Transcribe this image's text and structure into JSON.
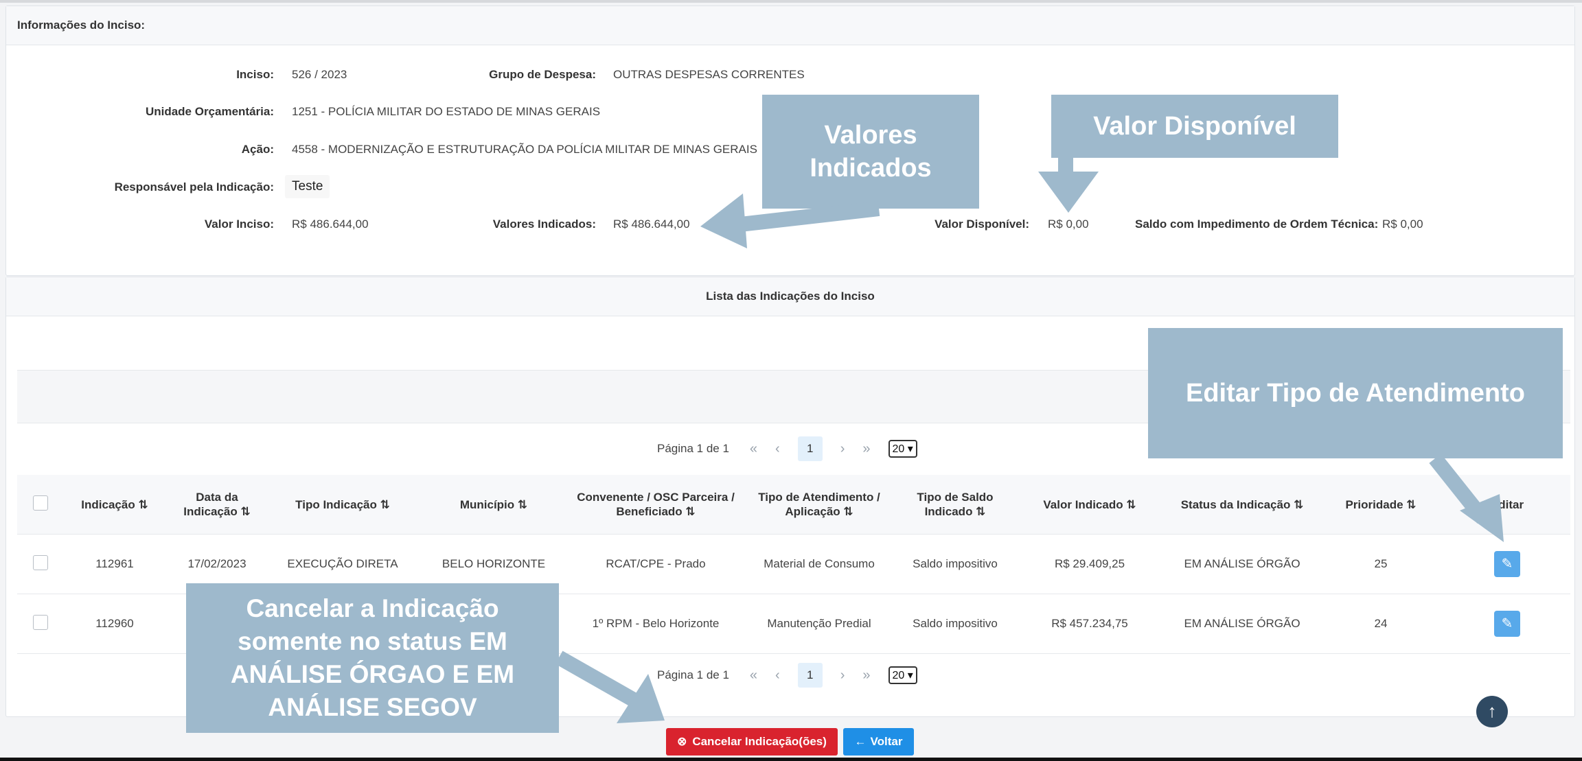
{
  "info": {
    "title": "Informações do Inciso:",
    "inciso_label": "Inciso:",
    "inciso_value": "526 / 2023",
    "grupo_label": "Grupo de Despesa:",
    "grupo_value": "OUTRAS DESPESAS CORRENTES",
    "unidade_label": "Unidade Orçamentária:",
    "unidade_value": "1251 - POLÍCIA MILITAR DO ESTADO DE MINAS GERAIS",
    "acao_label": "Ação:",
    "acao_value": "4558 - MODERNIZAÇÃO E ESTRUTURAÇÃO DA POLÍCIA MILITAR DE MINAS GERAIS",
    "responsavel_label": "Responsável pela Indicação:",
    "responsavel_value": "Teste",
    "valor_inciso_label": "Valor Inciso:",
    "valor_inciso_value": "R$ 486.644,00",
    "valores_indicados_label": "Valores Indicados:",
    "valores_indicados_value": "R$ 486.644,00",
    "valor_disponivel_label": "Valor Disponível:",
    "valor_disponivel_value": "R$ 0,00",
    "saldo_label": "Saldo com Impedimento de Ordem Técnica:",
    "saldo_value": "R$ 0,00"
  },
  "list": {
    "title": "Lista das Indicações do Inciso",
    "pager": {
      "text": "Página 1 de 1",
      "first": "«",
      "prev": "‹",
      "current": "1",
      "next": "›",
      "last": "»",
      "page_size": "20"
    },
    "columns": [
      "Indicação ⇅",
      "Data da Indicação ⇅",
      "Tipo Indicação ⇅",
      "Município ⇅",
      "Convenente / OSC Parceira / Beneficiado ⇅",
      "Tipo de Atendimento / Aplicação ⇅",
      "Tipo de Saldo Indicado ⇅",
      "Valor Indicado ⇅",
      "Status da Indicação ⇅",
      "Prioridade ⇅",
      "Editar"
    ],
    "rows": [
      {
        "indicacao": "112961",
        "data": "17/02/2023",
        "tipo": "EXECUÇÃO DIRETA",
        "municipio": "BELO HORIZONTE",
        "convenente": "RCAT/CPE - Prado",
        "atendimento": "Material de Consumo",
        "saldo": "Saldo impositivo",
        "valor": "R$ 29.409,25",
        "status": "EM ANÁLISE ÓRGÃO",
        "prioridade": "25"
      },
      {
        "indicacao": "112960",
        "data": "",
        "tipo": "",
        "municipio": "",
        "convenente": "1º RPM - Belo Horizonte",
        "atendimento": "Manutenção Predial",
        "saldo": "Saldo impositivo",
        "valor": "R$ 457.234,75",
        "status": "EM ANÁLISE ÓRGÃO",
        "prioridade": "24"
      }
    ]
  },
  "actions": {
    "cancel_label": "Cancelar Indicação(ões)",
    "back_label": "Voltar"
  },
  "icons": {
    "cancel": "x-circle-icon",
    "back": "arrow-left-icon",
    "edit": "pencil-icon",
    "scroll_top": "arrow-up-icon"
  },
  "annotations": {
    "valores_indicados": "Valores Indicados",
    "valor_disponivel": "Valor Disponível",
    "editar_tipo": "Editar Tipo de Atendimento",
    "cancelar": "Cancelar a Indicação somente no status EM ANÁLISE ÓRGAO E EM ANÁLISE SEGOV"
  },
  "colors": {
    "callout": "#9eb9cc",
    "cancel_button": "#d9232e",
    "back_button": "#1f8fe6",
    "edit_button": "#58a9ea"
  }
}
